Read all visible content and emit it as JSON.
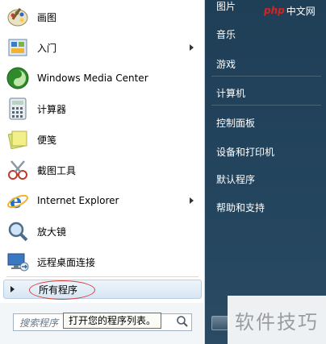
{
  "programs": [
    {
      "label": "画图",
      "icon": "paint-icon",
      "arrow": false
    },
    {
      "label": "入门",
      "icon": "getting-started-icon",
      "arrow": true
    },
    {
      "label": "Windows Media Center",
      "icon": "media-center-icon",
      "arrow": false
    },
    {
      "label": "计算器",
      "icon": "calculator-icon",
      "arrow": false
    },
    {
      "label": "便笺",
      "icon": "sticky-notes-icon",
      "arrow": false
    },
    {
      "label": "截图工具",
      "icon": "snipping-tool-icon",
      "arrow": false
    },
    {
      "label": "Internet Explorer",
      "icon": "internet-explorer-icon",
      "arrow": true
    },
    {
      "label": "放大镜",
      "icon": "magnifier-icon",
      "arrow": false
    },
    {
      "label": "远程桌面连接",
      "icon": "remote-desktop-icon",
      "arrow": false
    }
  ],
  "all_programs": "所有程序",
  "search": {
    "placeholder": "搜索程序",
    "tooltip": "打开您的程序列表。"
  },
  "right_links": [
    "图片",
    "音乐",
    "游戏",
    "计算机",
    "控制面板",
    "设备和打印机",
    "默认程序",
    "帮助和支持"
  ],
  "logo": {
    "php": "php",
    "cn": "中文网"
  },
  "watermark": "软件技巧",
  "colors": {
    "right_panel": "#24455e",
    "highlight_ellipse": "#d94141"
  }
}
